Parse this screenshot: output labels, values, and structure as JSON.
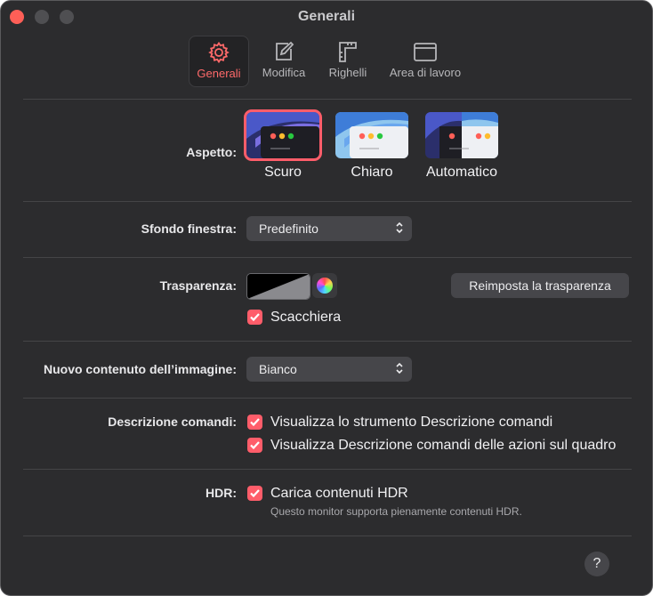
{
  "window": {
    "title": "Generali"
  },
  "toolbar": {
    "items": [
      {
        "label": "Generali",
        "icon": "gear-icon",
        "active": true
      },
      {
        "label": "Modifica",
        "icon": "edit-icon",
        "active": false
      },
      {
        "label": "Righelli",
        "icon": "ruler-icon",
        "active": false
      },
      {
        "label": "Area di lavoro",
        "icon": "window-icon",
        "active": false
      }
    ]
  },
  "appearance": {
    "label": "Aspetto:",
    "options": [
      {
        "caption": "Scuro",
        "selected": true
      },
      {
        "caption": "Chiaro",
        "selected": false
      },
      {
        "caption": "Automatico",
        "selected": false
      }
    ]
  },
  "background": {
    "label": "Sfondo finestra:",
    "value": "Predefinito"
  },
  "transparency": {
    "label": "Trasparenza:",
    "checkerboard_label": "Scacchiera",
    "checkerboard_checked": true,
    "reset_label": "Reimposta la trasparenza"
  },
  "new_content": {
    "label": "Nuovo contenuto dell’immagine:",
    "value": "Bianco"
  },
  "tooltips": {
    "label": "Descrizione comandi:",
    "opt1": "Visualizza lo strumento Descrizione comandi",
    "opt2": "Visualizza Descrizione comandi delle azioni sul quadro"
  },
  "hdr": {
    "label": "HDR:",
    "opt": "Carica contenuti HDR",
    "note": "Questo monitor supporta pienamente contenuti HDR."
  },
  "help": {
    "label": "?"
  },
  "colors": {
    "accent": "#ff5d6a",
    "window_bg": "#2c2c2e",
    "control_bg": "#46464a"
  }
}
